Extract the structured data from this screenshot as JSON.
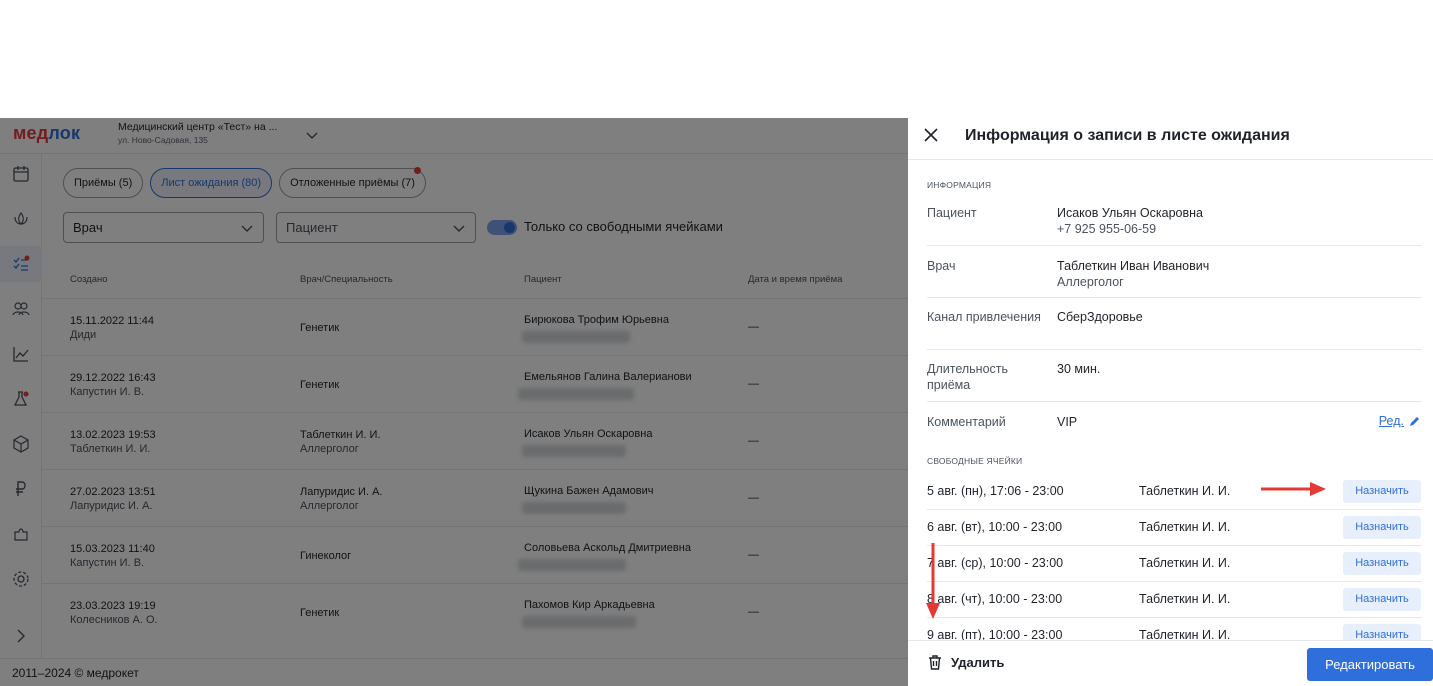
{
  "app": {
    "logo_part1": "мед",
    "logo_part2": "лок",
    "clinic_name": "Медицинский центр «Тест» на ...",
    "clinic_address": "ул. Ново-Садовая, 135",
    "footer": "2011–2024 © медрокет"
  },
  "tabs": [
    {
      "label": "Приёмы (5)"
    },
    {
      "label": "Лист ожидания (80)"
    },
    {
      "label": "Отложенные приёмы (7)"
    }
  ],
  "filters": {
    "doctor": "Врач",
    "patient": "Пациент",
    "toggle_label": "Только со свободными ячейками"
  },
  "table": {
    "headers": [
      "Создано",
      "Врач/Специальность",
      "Пациент",
      "Дата и время приёма"
    ],
    "rows": [
      {
        "date": "15.11.2022 11:44",
        "author": "Диди",
        "doctor": "Генетик",
        "doctor_sub": "",
        "patient": "Бирюкова Трофим Юрьевна",
        "appt": "—"
      },
      {
        "date": "29.12.2022 16:43",
        "author": "Капустин И. В.",
        "doctor": "Генетик",
        "doctor_sub": "",
        "patient": "Емельянов Галина Валерианови",
        "appt": "—"
      },
      {
        "date": "13.02.2023 19:53",
        "author": "Таблеткин И. И.",
        "doctor": "Таблеткин И. И.",
        "doctor_sub": "Аллерголог",
        "patient": "Исаков Ульян Оскаровна",
        "appt": "—"
      },
      {
        "date": "27.02.2023 13:51",
        "author": "Лапуридис И. А.",
        "doctor": "Лапуридис И. А.",
        "doctor_sub": "Аллерголог",
        "patient": "Щукина Бажен Адамович",
        "appt": "—"
      },
      {
        "date": "15.03.2023 11:40",
        "author": "Капустин И. В.",
        "doctor": "Гинеколог",
        "doctor_sub": "",
        "patient": "Соловьева Аскольд Дмитриевна",
        "appt": "—"
      },
      {
        "date": "23.03.2023 19:19",
        "author": "Колесников А. О.",
        "doctor": "Генетик",
        "doctor_sub": "",
        "patient": "Пахомов Кир Аркадьевна",
        "appt": "—"
      }
    ]
  },
  "drawer": {
    "title": "Информация о записи в листе ожидания",
    "section_info": "ИНФОРМАЦИЯ",
    "patient_label": "Пациент",
    "patient_name": "Исаков Ульян Оскаровна",
    "patient_phone": "+7 925 955-06-59",
    "doctor_label": "Врач",
    "doctor_name": "Таблеткин Иван Иванович",
    "doctor_spec": "Аллерголог",
    "channel_label": "Канал привлечения",
    "channel_value": "СберЗдоровье",
    "duration_label": "Длительность приёма",
    "duration_value": "30 мин.",
    "comment_label": "Комментарий",
    "comment_value": "VIP",
    "edit_link": "Ред.",
    "section_slots": "СВОБОДНЫЕ ЯЧЕЙКИ",
    "slots": [
      {
        "time": "5 авг. (пн), 17:06 - 23:00",
        "doctor": "Таблеткин И. И.",
        "button": "Назначить"
      },
      {
        "time": "6 авг. (вт), 10:00 - 23:00",
        "doctor": "Таблеткин И. И.",
        "button": "Назначить"
      },
      {
        "time": "7 авг. (ср), 10:00 - 23:00",
        "doctor": "Таблеткин И. И.",
        "button": "Назначить"
      },
      {
        "time": "8 авг. (чт), 10:00 - 23:00",
        "doctor": "Таблеткин И. И.",
        "button": "Назначить"
      },
      {
        "time": "9 авг. (пт), 10:00 - 23:00",
        "doctor": "Таблеткин И. И.",
        "button": "Назначить"
      }
    ],
    "delete_label": "Удалить",
    "edit_button": "Редактировать"
  },
  "colors": {
    "accent": "#2f6fdb",
    "brand_red": "#e8383d",
    "annotation_arrow": "#e53935"
  }
}
